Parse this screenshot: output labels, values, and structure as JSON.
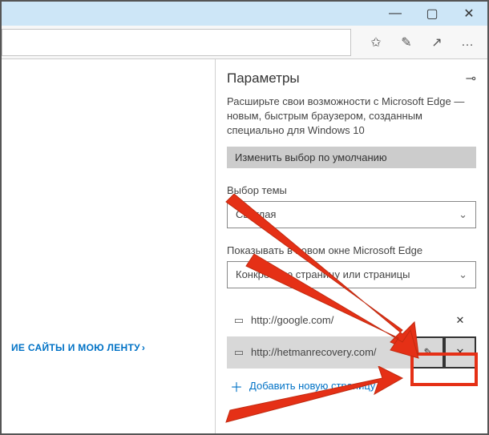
{
  "window_controls": {
    "minimize": "—",
    "maximize": "▢",
    "close": "✕"
  },
  "toolbar_icons": {
    "fav": "✩",
    "ink": "✎",
    "share": "↗",
    "more": "…"
  },
  "panel": {
    "title": "Параметры",
    "pin_icon": "⊸",
    "description": "Расширьте свои возможности с Microsoft Edge — новым, быстрым браузером, созданным специально для Windows 10",
    "default_button": "Изменить выбор по умолчанию",
    "theme_label": "Выбор темы",
    "theme_value": "Светлая",
    "show_label": "Показывать в новом окне Microsoft Edge",
    "show_value": "Конкретную страницу или страницы",
    "pages": [
      {
        "url": "http://google.com/",
        "selected": false
      },
      {
        "url": "http://hetmanrecovery.com/",
        "selected": true
      }
    ],
    "add_label": "Добавить новую страницу"
  },
  "main_link_fragment": "ИЕ САЙТЫ И МОЮ ЛЕНТУ",
  "icons": {
    "page": "▭",
    "edit": "✎",
    "remove": "✕",
    "plus": "＋",
    "chevron": "⌄"
  }
}
